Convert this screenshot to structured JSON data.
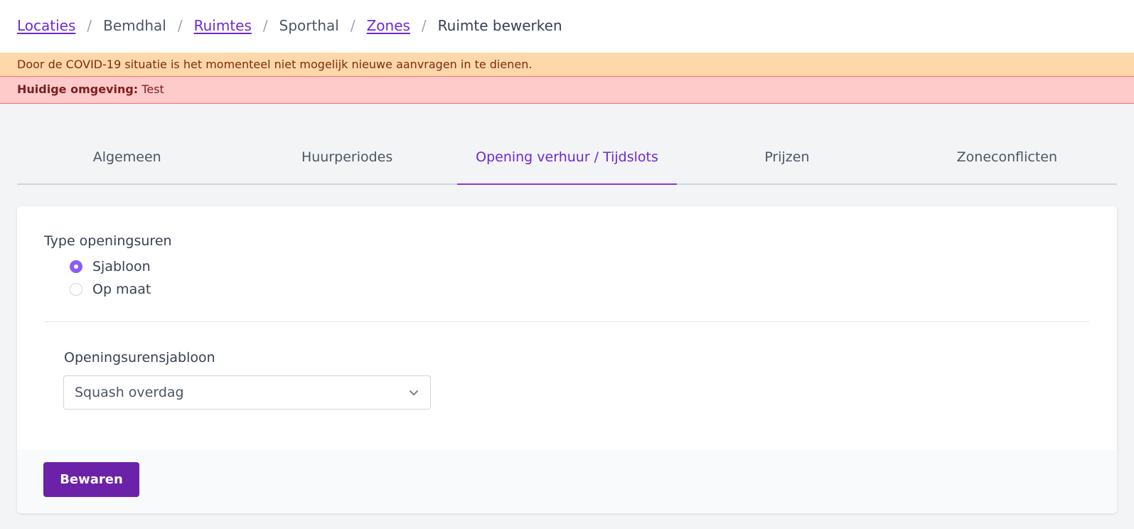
{
  "breadcrumb": {
    "items": [
      {
        "label": "Locaties",
        "link": true
      },
      {
        "label": "Bemdhal",
        "link": false
      },
      {
        "label": "Ruimtes",
        "link": true
      },
      {
        "label": "Sporthal",
        "link": false
      },
      {
        "label": "Zones",
        "link": true
      },
      {
        "label": "Ruimte bewerken",
        "link": false
      }
    ],
    "separator": "/"
  },
  "alerts": {
    "warning": "Door de COVID-19 situatie is het momenteel niet mogelijk nieuwe aanvragen in te dienen.",
    "environment_label": "Huidige omgeving:",
    "environment_value": "Test"
  },
  "tabs": [
    {
      "label": "Algemeen",
      "active": false
    },
    {
      "label": "Huurperiodes",
      "active": false
    },
    {
      "label": "Opening verhuur / Tijdslots",
      "active": true
    },
    {
      "label": "Prijzen",
      "active": false
    },
    {
      "label": "Zoneconflicten",
      "active": false
    }
  ],
  "form": {
    "type_label": "Type openingsuren",
    "options": [
      {
        "label": "Sjabloon",
        "checked": true
      },
      {
        "label": "Op maat",
        "checked": false
      }
    ],
    "template_label": "Openingsurensjabloon",
    "template_value": "Squash overdag",
    "save_label": "Bewaren"
  },
  "colors": {
    "accent": "#6d28d9",
    "button": "#6b21a8",
    "warning_bg": "#fed7aa",
    "env_bg": "#fecaca"
  },
  "icons": {
    "select": "chevron-down-icon"
  }
}
